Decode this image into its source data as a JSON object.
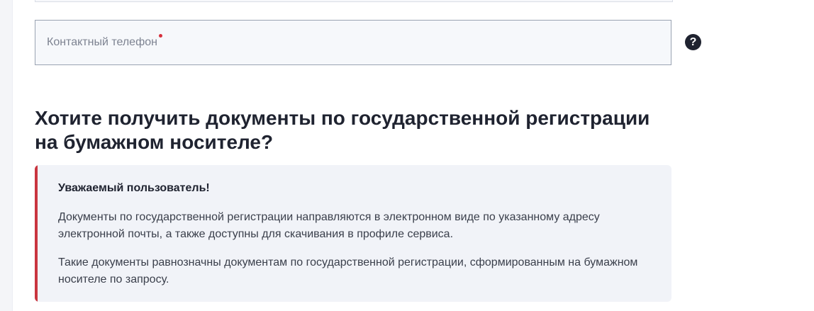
{
  "form": {
    "phone_label": "Контактный телефон",
    "phone_value": "",
    "help_glyph": "?"
  },
  "section": {
    "title": "Хотите получить документы по государственной регистрации на бумажном носителе?"
  },
  "notice": {
    "heading": "Уважаемый пользователь!",
    "paragraph_1": "Документы по государственной регистрации направляются в электронном виде по указанному адресу электронной почты, а также доступны для скачивания в профиле сервиса.",
    "paragraph_2": "Такие документы равнозначны документам по государственной регистрации, сформированным на бумажном носителе по запросу."
  },
  "colors": {
    "accent_red": "#c9353f",
    "required_dot": "#d62f3b",
    "text_dark": "#1f2330",
    "notice_bg": "#f1f3f8"
  }
}
